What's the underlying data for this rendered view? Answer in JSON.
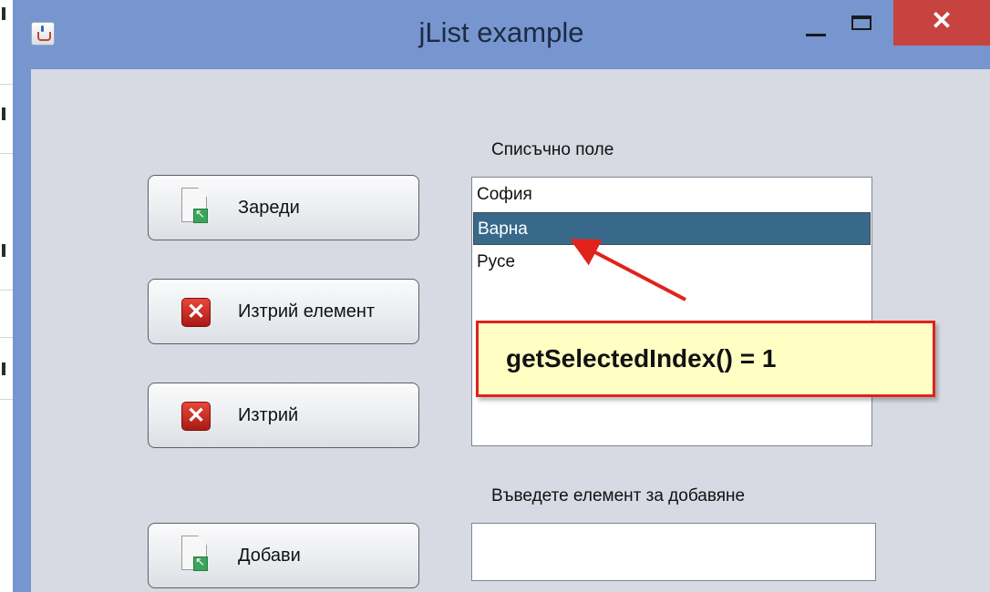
{
  "window": {
    "title": "jList example",
    "close_symbol": "✕"
  },
  "buttons": {
    "load": {
      "label": "Зареди",
      "icon": "document-icon"
    },
    "remove_item": {
      "label": "Изтрий елемент",
      "icon": "delete-icon"
    },
    "clear": {
      "label": "Изтрий",
      "icon": "delete-icon"
    },
    "add": {
      "label": "Добави",
      "icon": "document-icon"
    }
  },
  "list": {
    "label": "Списъчно поле",
    "items": [
      "София",
      "Варна",
      "Русе"
    ],
    "selected_index": 1
  },
  "input": {
    "label": "Въведете елемент за добавяне",
    "value": ""
  },
  "annotation": {
    "text": "getSelectedIndex() = 1"
  },
  "colors": {
    "selection": "#39698a",
    "callout_border": "#e1221c",
    "callout_fill": "#ffffc4",
    "titlebar": "#7796cf",
    "close_button": "#c7433f"
  }
}
